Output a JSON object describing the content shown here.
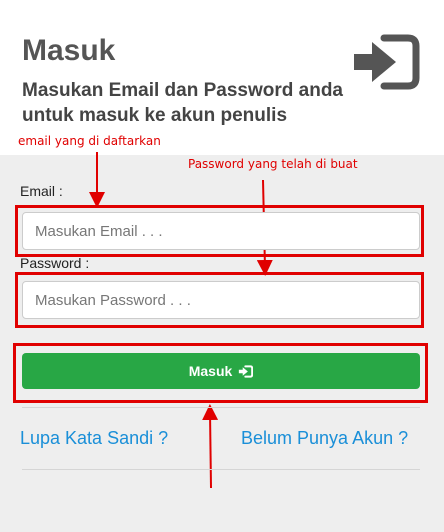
{
  "header": {
    "title": "Masuk",
    "subtitle": "Masukan Email dan Password anda untuk masuk ke akun penulis",
    "icon": "sign-in-icon"
  },
  "annotations": {
    "email_note": "email yang di daftarkan",
    "password_note": "Password yang telah di buat",
    "color": "#e00000"
  },
  "form": {
    "email_label": "Email :",
    "email_placeholder": "Masukan Email . . .",
    "email_value": "",
    "password_label": "Password :",
    "password_placeholder": "Masukan Password . . .",
    "password_value": "",
    "submit_label": "Masuk",
    "submit_icon": "sign-in-icon",
    "submit_color": "#28a745"
  },
  "links": {
    "forgot": "Lupa Kata Sandi ?",
    "register": "Belum Punya Akun ?",
    "color": "#1a8fd8"
  }
}
